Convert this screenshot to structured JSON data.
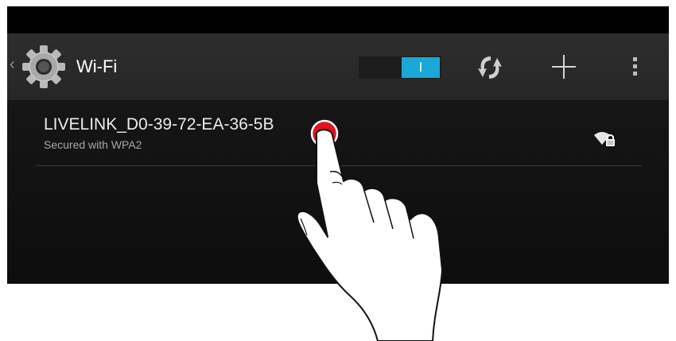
{
  "header": {
    "title": "Wi-Fi",
    "toggle_state_label": "I",
    "toggle_on": true
  },
  "networks": [
    {
      "ssid": "LIVELINK_D0-39-72-EA-36-5B",
      "security": "Secured with WPA2",
      "signal_icon": "wifi-locked-icon"
    }
  ],
  "icons": {
    "back": "chevron-left-icon",
    "settings": "gear-icon",
    "sync": "sync-icon",
    "add": "plus-icon",
    "menu": "overflow-menu-icon",
    "touch_indicator": "hand-tap-icon"
  },
  "colors": {
    "accent": "#1aa8d6",
    "action_bar": "#2a2a2a",
    "tap_marker": "#e0141e"
  }
}
